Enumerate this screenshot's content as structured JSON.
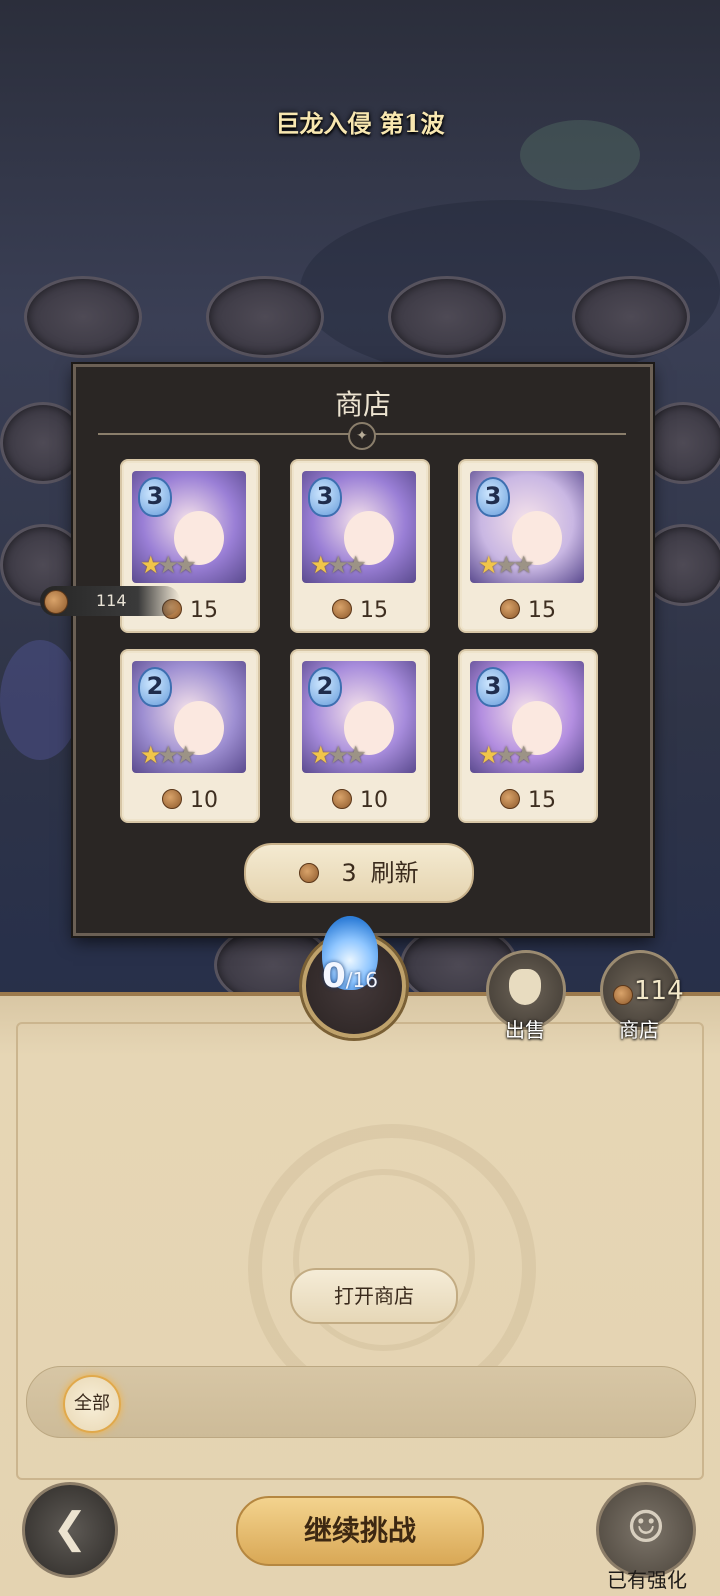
{
  "header": {
    "wave_title": "巨龙入侵 第1波"
  },
  "shop": {
    "title": "商店",
    "cards": [
      {
        "tier": "3",
        "stars": 1,
        "price": "15",
        "color": "#9a7fd6"
      },
      {
        "tier": "3",
        "stars": 1,
        "price": "15",
        "color": "#9a7fd6"
      },
      {
        "tier": "3",
        "stars": 1,
        "price": "15",
        "color": "#c9b7e3"
      },
      {
        "tier": "2",
        "stars": 1,
        "price": "10",
        "color": "#9e8fd2"
      },
      {
        "tier": "2",
        "stars": 1,
        "price": "10",
        "color": "#a78cdc"
      },
      {
        "tier": "3",
        "stars": 1,
        "price": "15",
        "color": "#b38ee0"
      }
    ],
    "refresh_cost": "3",
    "refresh_label": "刷新"
  },
  "coins": {
    "pill_amount": "114",
    "amount": "114"
  },
  "counter": {
    "current": "0",
    "max": "/16"
  },
  "buttons": {
    "sell": "出售",
    "shop": "商店",
    "open_shop": "打开商店",
    "filter_all": "全部",
    "continue": "继续挑战",
    "enhanced": "已有强化"
  },
  "icons": [
    "coin-icon",
    "sell-bag-icon",
    "shop-icon",
    "back-icon",
    "hero-icon",
    "compass-ornament-icon",
    "star-icon"
  ]
}
